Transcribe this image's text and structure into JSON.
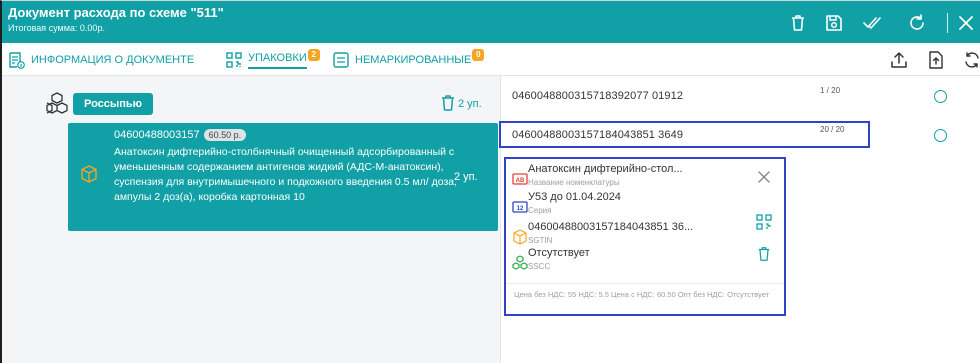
{
  "header": {
    "title": "Документ расхода по схеме \"511\"",
    "subtitle": "Итоговая сумма: 0.00р.",
    "icons": [
      "trash-icon",
      "save-icon",
      "check-all-icon",
      "refresh-icon",
      "close-icon"
    ]
  },
  "tabs": [
    {
      "label": "ИНФОРМАЦИЯ О ДОКУМЕНТЕ",
      "icon": "document-info-icon",
      "badge": ""
    },
    {
      "label": "УПАКОВКИ",
      "icon": "qr-code-icon",
      "badge": "2",
      "active": true
    },
    {
      "label": "НЕМАРКИРОВАННЫЕ",
      "icon": "list-icon",
      "badge": "0"
    }
  ],
  "tab_actions": [
    "upload-icon",
    "file-export-icon",
    "sync-icon"
  ],
  "left": {
    "group_label": "Россыпью",
    "group_qty": "2 уп.",
    "item": {
      "code": "04600488003157",
      "price": "60.50 р.",
      "description": "Анатоксин дифтерийно-столбнячный очищенный адсорбированный с уменьшенным содержанием антигенов жидкий (АДС-М-анатоксин), суспензия для внутримышечного и подкожного введения 0.5 мл/ доза, ампулы 2 доз(а), коробка картонная 10",
      "qty": "2 уп."
    }
  },
  "right": {
    "rows": [
      {
        "code": "0460048800315718392077 01912",
        "count": "1 / 20"
      },
      {
        "code": "04600488003157184043851 3649",
        "count": "20 / 20"
      }
    ],
    "detail": {
      "name": "Анатоксин дифтерийно-стол...",
      "name_label": "Название номенклатуры",
      "series": "У53 до 01.04.2024",
      "series_label": "Серия",
      "sgtin": "04600488003157184043851 36...",
      "sgtin_label": "SGTIN",
      "sscc": "Отсутствует",
      "sscc_label": "SSCC",
      "footer": "Цена без НДС: 55  НДС: 5.5  Цена с НДС: 60.50  Опт без НДС: Отсутствует"
    }
  },
  "colors": {
    "accent": "#11a0a6",
    "badge": "#f5a623",
    "highlight": "#2f44c8"
  }
}
